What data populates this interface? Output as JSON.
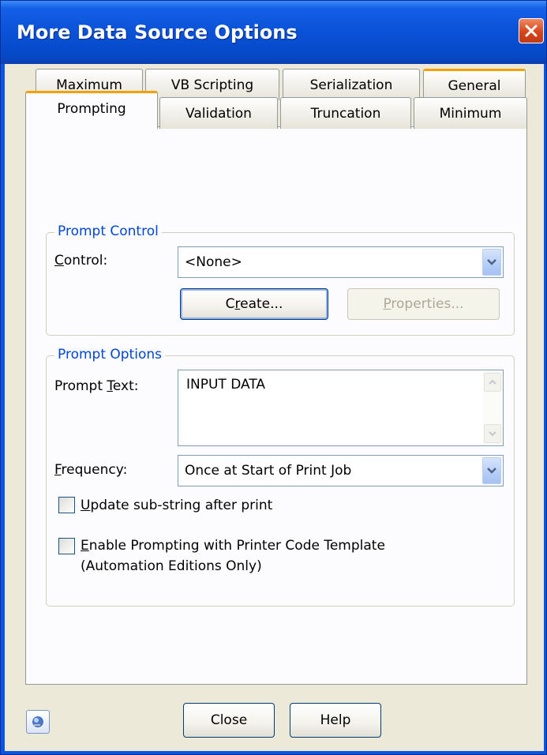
{
  "window": {
    "title": "More Data Source Options",
    "close_icon": "close-icon"
  },
  "tabs": {
    "row_back": [
      {
        "label": "Maximum"
      },
      {
        "label": "VB Scripting"
      },
      {
        "label": "Serialization"
      },
      {
        "label": "General"
      }
    ],
    "row_front": [
      {
        "label": "Prompting",
        "selected": true
      },
      {
        "label": "Validation"
      },
      {
        "label": "Truncation"
      },
      {
        "label": "Minimum"
      }
    ]
  },
  "prompt_control": {
    "title": "Prompt Control",
    "control_label_accel": "C",
    "control_label_rest": "ontrol:",
    "control_value": "<None>",
    "create_accel_pre": "C",
    "create_accel": "r",
    "create_rest": "eate...",
    "properties_accel": "P",
    "properties_rest": "roperties..."
  },
  "prompt_options": {
    "title": "Prompt Options",
    "prompt_text_label_pre": "Prompt ",
    "prompt_text_label_accel": "T",
    "prompt_text_label_rest": "ext:",
    "prompt_text_value": "INPUT DATA",
    "frequency_label_accel": "F",
    "frequency_label_rest": "requency:",
    "frequency_value": "Once at Start of Print Job",
    "update_checkbox_accel": "U",
    "update_checkbox_rest": "pdate sub-string after print",
    "update_checked": false,
    "enable_checkbox_accel": "E",
    "enable_checkbox_rest": "nable Prompting with Printer Code Template",
    "enable_checkbox_line2": "(Automation Editions Only)",
    "enable_checked": false
  },
  "footer": {
    "close_label": "Close",
    "help_label": "Help",
    "context_help_icon": "context-help-icon"
  },
  "colors": {
    "titlebar": "#0a52d8",
    "dialog_face": "#ece9d8",
    "group_title": "#0046d5",
    "tab_hot": "#f4a000"
  }
}
